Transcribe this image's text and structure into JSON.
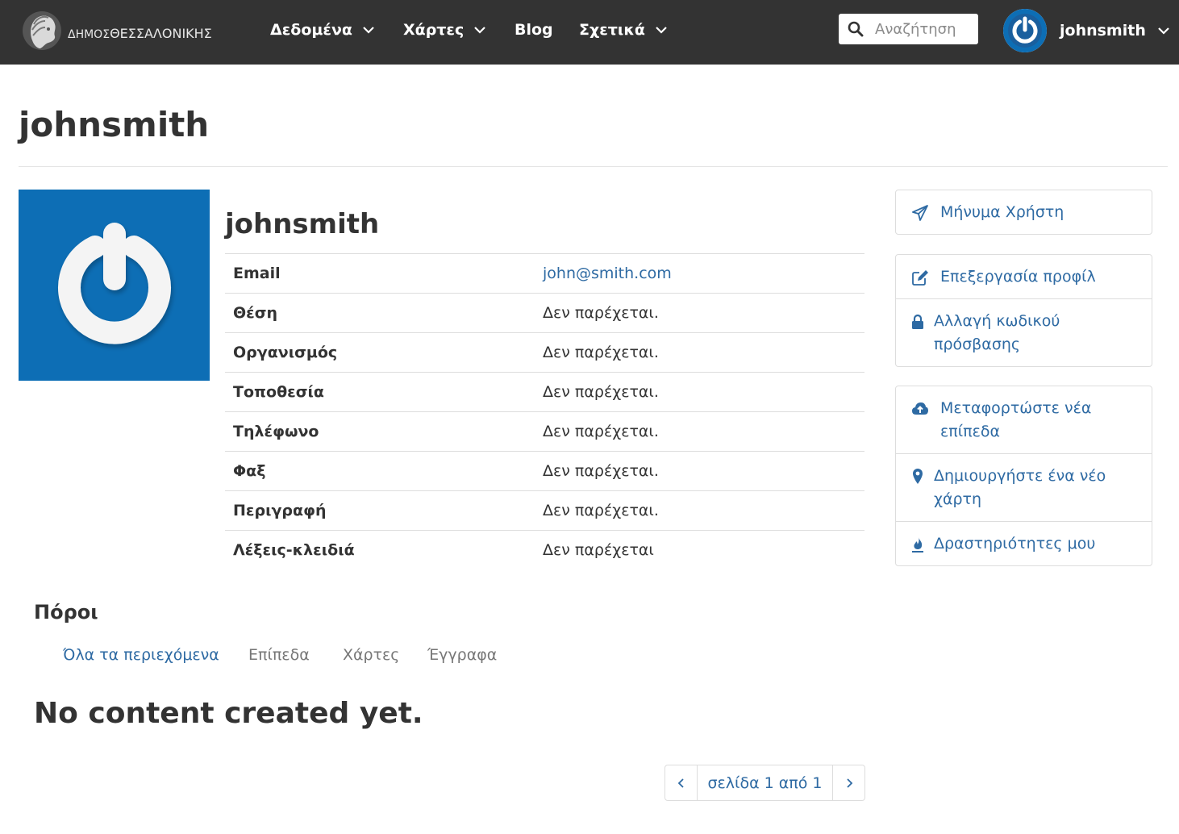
{
  "navbar": {
    "logo_text_prefix": "ΔΗΜΟΣ",
    "logo_text_main": "ΘΕΣΣΑΛΟΝΙΚΗΣ",
    "items": [
      {
        "label": "Δεδομένα",
        "has_dropdown": true
      },
      {
        "label": "Χάρτες",
        "has_dropdown": true
      },
      {
        "label": "Blog",
        "has_dropdown": false
      },
      {
        "label": "Σχετικά",
        "has_dropdown": true
      }
    ],
    "search_placeholder": "Αναζήτηση",
    "username": "johnsmith"
  },
  "page": {
    "title": "johnsmith"
  },
  "profile": {
    "name": "johnsmith",
    "fields": [
      {
        "label": "Email",
        "value": "john@smith.com",
        "is_link": true
      },
      {
        "label": "Θέση",
        "value": "Δεν παρέχεται."
      },
      {
        "label": "Οργανισμός",
        "value": "Δεν παρέχεται."
      },
      {
        "label": "Τοποθεσία",
        "value": "Δεν παρέχεται."
      },
      {
        "label": "Τηλέφωνο",
        "value": "Δεν παρέχεται."
      },
      {
        "label": "Φαξ",
        "value": "Δεν παρέχεται."
      },
      {
        "label": "Περιγραφή",
        "value": "Δεν παρέχεται."
      },
      {
        "label": "Λέξεις-κλειδιά",
        "value": "Δεν παρέχεται"
      }
    ]
  },
  "actions": {
    "message_user": "Μήνυμα Χρήστη",
    "edit_profile": "Επεξεργασία προφίλ",
    "change_password": "Αλλαγή κωδικού πρόσβασης",
    "upload_layers": "Μεταφορτώστε νέα επίπεδα",
    "create_map": "Δημιουργήστε ένα νέο χάρτη",
    "my_activities": "Δραστηριότητες μου"
  },
  "resources": {
    "title": "Πόροι",
    "tabs": [
      {
        "label": "Όλα τα περιεχόμενα",
        "active": true
      },
      {
        "label": "Επίπεδα",
        "active": false
      },
      {
        "label": "Χάρτες",
        "active": false
      },
      {
        "label": "Έγγραφα",
        "active": false
      }
    ],
    "empty_message": "No content created yet."
  },
  "pagination": {
    "label": "σελίδα 1 από 1"
  },
  "colors": {
    "navbar_bg": "#333333",
    "link": "#2e6aa3",
    "avatar_bg": "#0d6eb5",
    "border": "#dddddd"
  },
  "icons": {
    "logo": "alexander-head-logo",
    "search": "search-icon",
    "dropdown": "chevron-down-icon",
    "avatar": "power-icon",
    "message": "paper-plane-icon",
    "edit": "edit-icon",
    "password": "lock-icon",
    "upload": "cloud-upload-icon",
    "map": "map-marker-icon",
    "activities": "fire-icon",
    "prev": "chevron-left-icon",
    "next": "chevron-right-icon"
  }
}
